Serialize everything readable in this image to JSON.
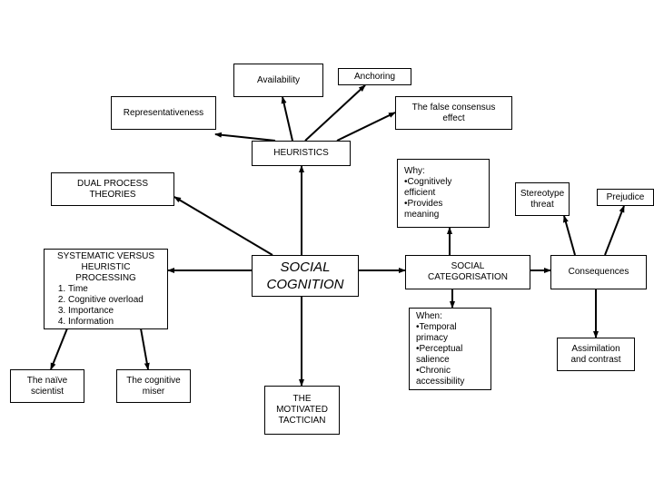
{
  "nodes": {
    "availability": "Availability",
    "anchoring": "Anchoring",
    "representativeness": "Representativeness",
    "false_consensus": [
      "The false consensus",
      "effect"
    ],
    "heuristics": "HEURISTICS",
    "dual_process": [
      "DUAL PROCESS",
      "THEORIES"
    ],
    "why": [
      "Why:",
      "•Cognitively",
      "efficient",
      "•Provides",
      "meaning"
    ],
    "stereotype_threat": [
      "Stereotype",
      "threat"
    ],
    "prejudice": "Prejudice",
    "systematic": {
      "title": [
        "SYSTEMATIC VERSUS",
        "HEURISTIC",
        "PROCESSING"
      ],
      "items": [
        "Time",
        "Cognitive overload",
        "Importance",
        "Information"
      ]
    },
    "social_cognition": [
      "SOCIAL",
      "COGNITION"
    ],
    "social_categorisation": [
      "SOCIAL",
      "CATEGORISATION"
    ],
    "consequences": "Consequences",
    "when": [
      "When:",
      "•Temporal",
      "primacy",
      "•Perceptual",
      "salience",
      "•Chronic",
      "accessibility"
    ],
    "assimilation": [
      "Assimilation",
      "and contrast"
    ],
    "naive_scientist": [
      "The naïve",
      "scientist"
    ],
    "cognitive_miser": [
      "The cognitive",
      "miser"
    ],
    "motivated_tactician": [
      "THE",
      "MOTIVATED",
      "TACTICIAN"
    ]
  }
}
